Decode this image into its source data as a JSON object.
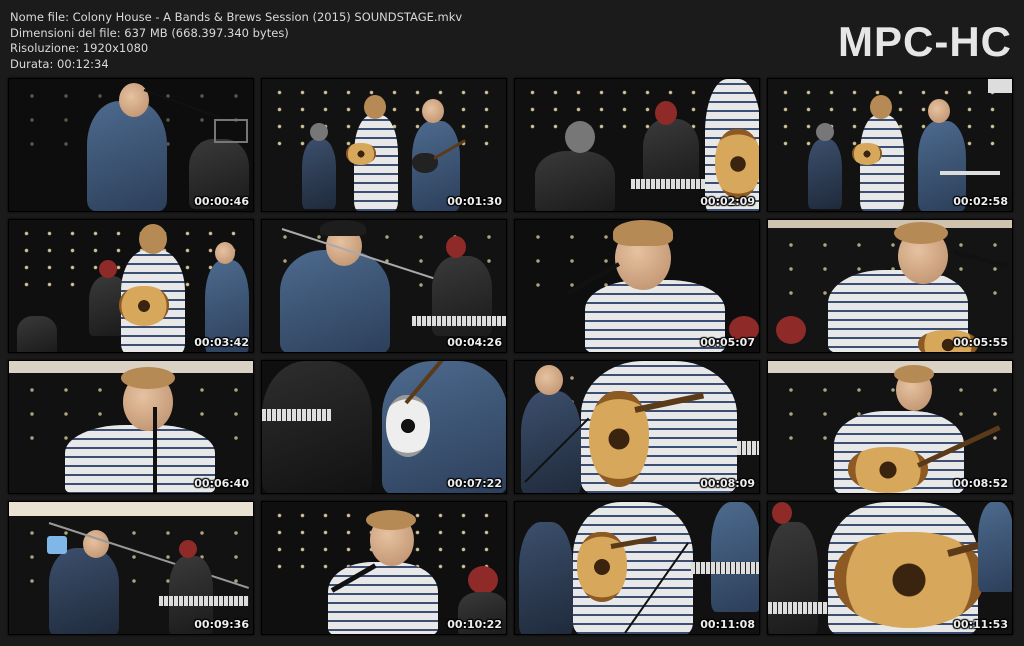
{
  "header": {
    "file_name": "Nome file: Colony House - A Bands & Brews Session (2015) SOUNDSTAGE.mkv",
    "file_size": "Dimensioni del file: 637 MB (668.397.340 bytes)",
    "resolution": "Risoluzione: 1920x1080",
    "duration": "Durata: 00:12:34",
    "logo": "MPC-HC"
  },
  "thumbnails": [
    {
      "time": "00:00:46"
    },
    {
      "time": "00:01:30"
    },
    {
      "time": "00:02:09"
    },
    {
      "time": "00:02:58"
    },
    {
      "time": "00:03:42"
    },
    {
      "time": "00:04:26"
    },
    {
      "time": "00:05:07"
    },
    {
      "time": "00:05:55"
    },
    {
      "time": "00:06:40"
    },
    {
      "time": "00:07:22"
    },
    {
      "time": "00:08:09"
    },
    {
      "time": "00:08:52"
    },
    {
      "time": "00:09:36"
    },
    {
      "time": "00:10:22"
    },
    {
      "time": "00:11:08"
    },
    {
      "time": "00:11:53"
    }
  ],
  "colors": {
    "background": "#1b1b1b",
    "text": "#d9d9d9",
    "logo": "#e6e6e6"
  }
}
